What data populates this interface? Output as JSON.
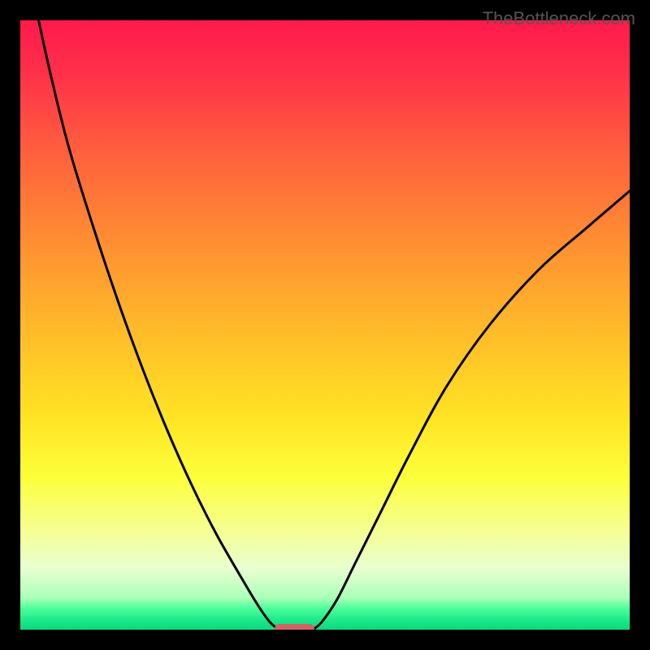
{
  "watermark": "TheBottleneck.com",
  "chart_data": {
    "type": "line",
    "title": "",
    "xlabel": "",
    "ylabel": "",
    "xlim": [
      0,
      100
    ],
    "ylim": [
      0,
      100
    ],
    "gradient_stops": [
      {
        "offset": 0.0,
        "color": "#ff1a4b"
      },
      {
        "offset": 0.08,
        "color": "#ff2e4a"
      },
      {
        "offset": 0.2,
        "color": "#ff5a3e"
      },
      {
        "offset": 0.35,
        "color": "#ff8a33"
      },
      {
        "offset": 0.5,
        "color": "#ffb82a"
      },
      {
        "offset": 0.65,
        "color": "#ffe324"
      },
      {
        "offset": 0.75,
        "color": "#fcff3a"
      },
      {
        "offset": 0.84,
        "color": "#f5ff95"
      },
      {
        "offset": 0.9,
        "color": "#e8ffd0"
      },
      {
        "offset": 0.948,
        "color": "#aaffb8"
      },
      {
        "offset": 0.965,
        "color": "#4cff9a"
      },
      {
        "offset": 0.985,
        "color": "#1ae88a"
      },
      {
        "offset": 1.0,
        "color": "#0fd87d"
      }
    ],
    "series": [
      {
        "name": "left-branch",
        "x": [
          3,
          5,
          8,
          12,
          16,
          20,
          24,
          28,
          32,
          36,
          39,
          41,
          42.5
        ],
        "y": [
          100,
          91,
          79,
          66,
          54,
          43,
          33,
          24,
          16,
          9,
          4,
          1.2,
          0
        ]
      },
      {
        "name": "right-branch",
        "x": [
          48,
          49.5,
          52,
          55,
          59,
          64,
          70,
          77,
          85,
          93,
          100
        ],
        "y": [
          0,
          1.3,
          5,
          11,
          19,
          29,
          40,
          50,
          59,
          66,
          72
        ]
      }
    ],
    "marker": {
      "x_center": 45.0,
      "y": 0.0,
      "width": 6.5,
      "color": "#d06464"
    }
  }
}
